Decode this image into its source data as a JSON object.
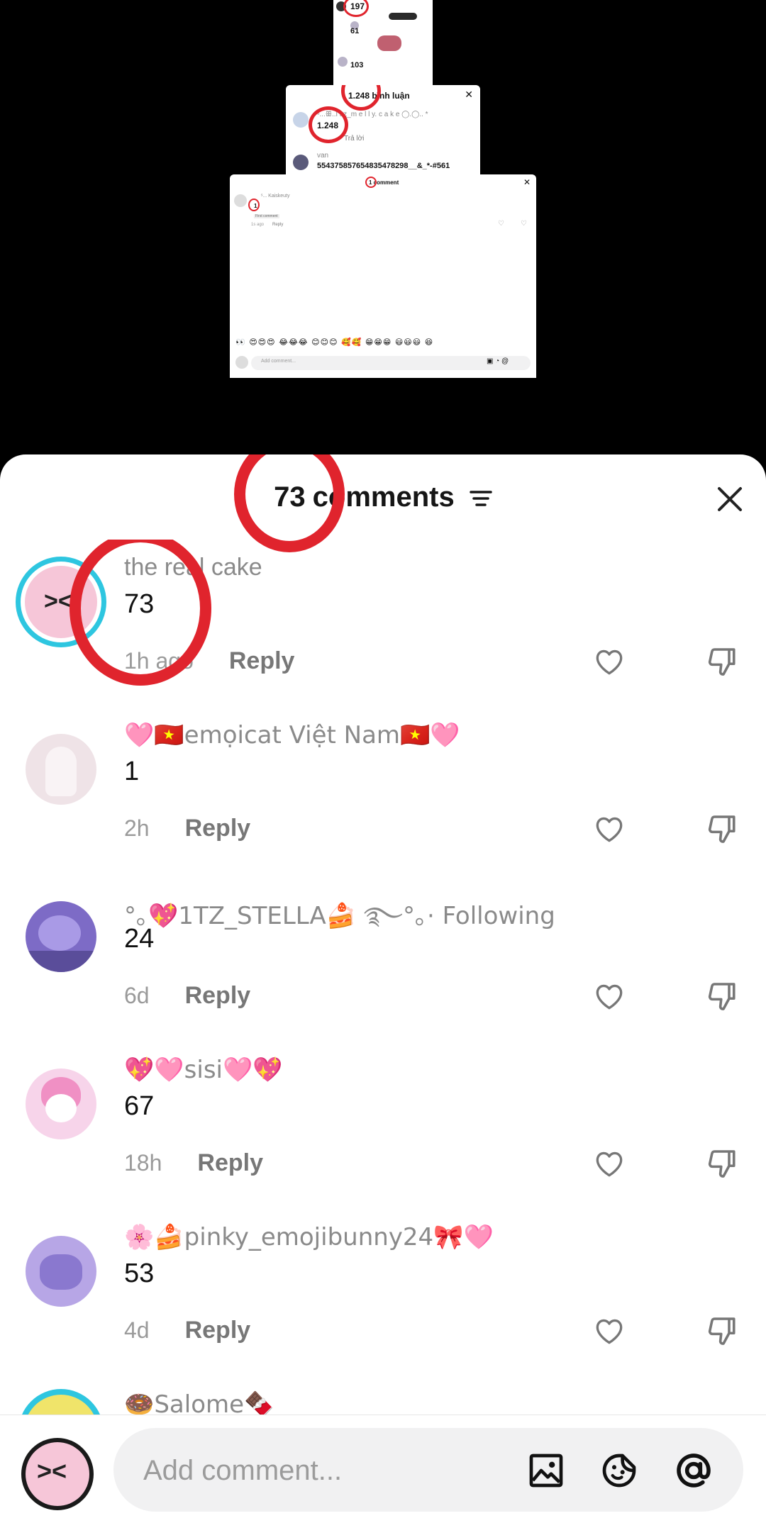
{
  "header": {
    "count": "73",
    "title_rest": "comments",
    "filter_icon": "filter-lines-icon",
    "close_icon": "close-x-icon"
  },
  "top_collage": {
    "panel1": {
      "count": "197",
      "row2": "61",
      "row3": "103"
    },
    "panel2": {
      "header": "1.248 bình luận",
      "user": "ˢ...ꕥ..l t z_m e l l y. c a k e ◯.◯.. *",
      "count": "1.248",
      "reply": "Trả lời",
      "user2": "van",
      "text2": "5543758576548354782​98__&_*-#561"
    },
    "panel3": {
      "header": "1 comment",
      "user": "ˢ... Kaiskeuty  ",
      "count": "1",
      "pinned": "First comment",
      "time": "1s ago",
      "reply": "Reply",
      "emojis": "👀 😍😍😍 😂😂😂 😊😊😊 🥰🥰 😁😁😁 😃😃😃 😆",
      "placeholder": "Add comment..."
    }
  },
  "comments": [
    {
      "user": "the real cake",
      "text": "73",
      "time": "1h ago",
      "reply": "Reply",
      "avatar_color": "#f6c6d8"
    },
    {
      "user": "🩷🇻🇳emọicat  Việt Nam🇻🇳🩷",
      "text": "1",
      "time": "2h",
      "reply": "Reply",
      "avatar_color": "#efe3e7"
    },
    {
      "user": "°｡💖1TZ_STELLA🍰 ࿐°｡· Following",
      "text": "24",
      "time": "6d",
      "reply": "Reply",
      "avatar_color": "#7d6bc6"
    },
    {
      "user": "💖🩷sisi🩷💖",
      "text": "67",
      "time": "18h",
      "reply": "Reply",
      "avatar_color": "#f7d4ea"
    },
    {
      "user": "🌸🍰pinky_emojibunny24🎀🩷",
      "text": "53",
      "time": "4d",
      "reply": "Reply",
      "avatar_color": "#b7a6e6"
    },
    {
      "user": "🍩Salome🍫",
      "text": "",
      "time": "",
      "reply": "",
      "avatar_color": "#7fc7e8"
    }
  ],
  "input": {
    "placeholder": "Add comment...",
    "icons": [
      "image-icon",
      "sticker-icon",
      "mention-at-icon"
    ]
  },
  "colors": {
    "accent_red": "#e0242d",
    "text_gray": "#8a8a8a"
  }
}
